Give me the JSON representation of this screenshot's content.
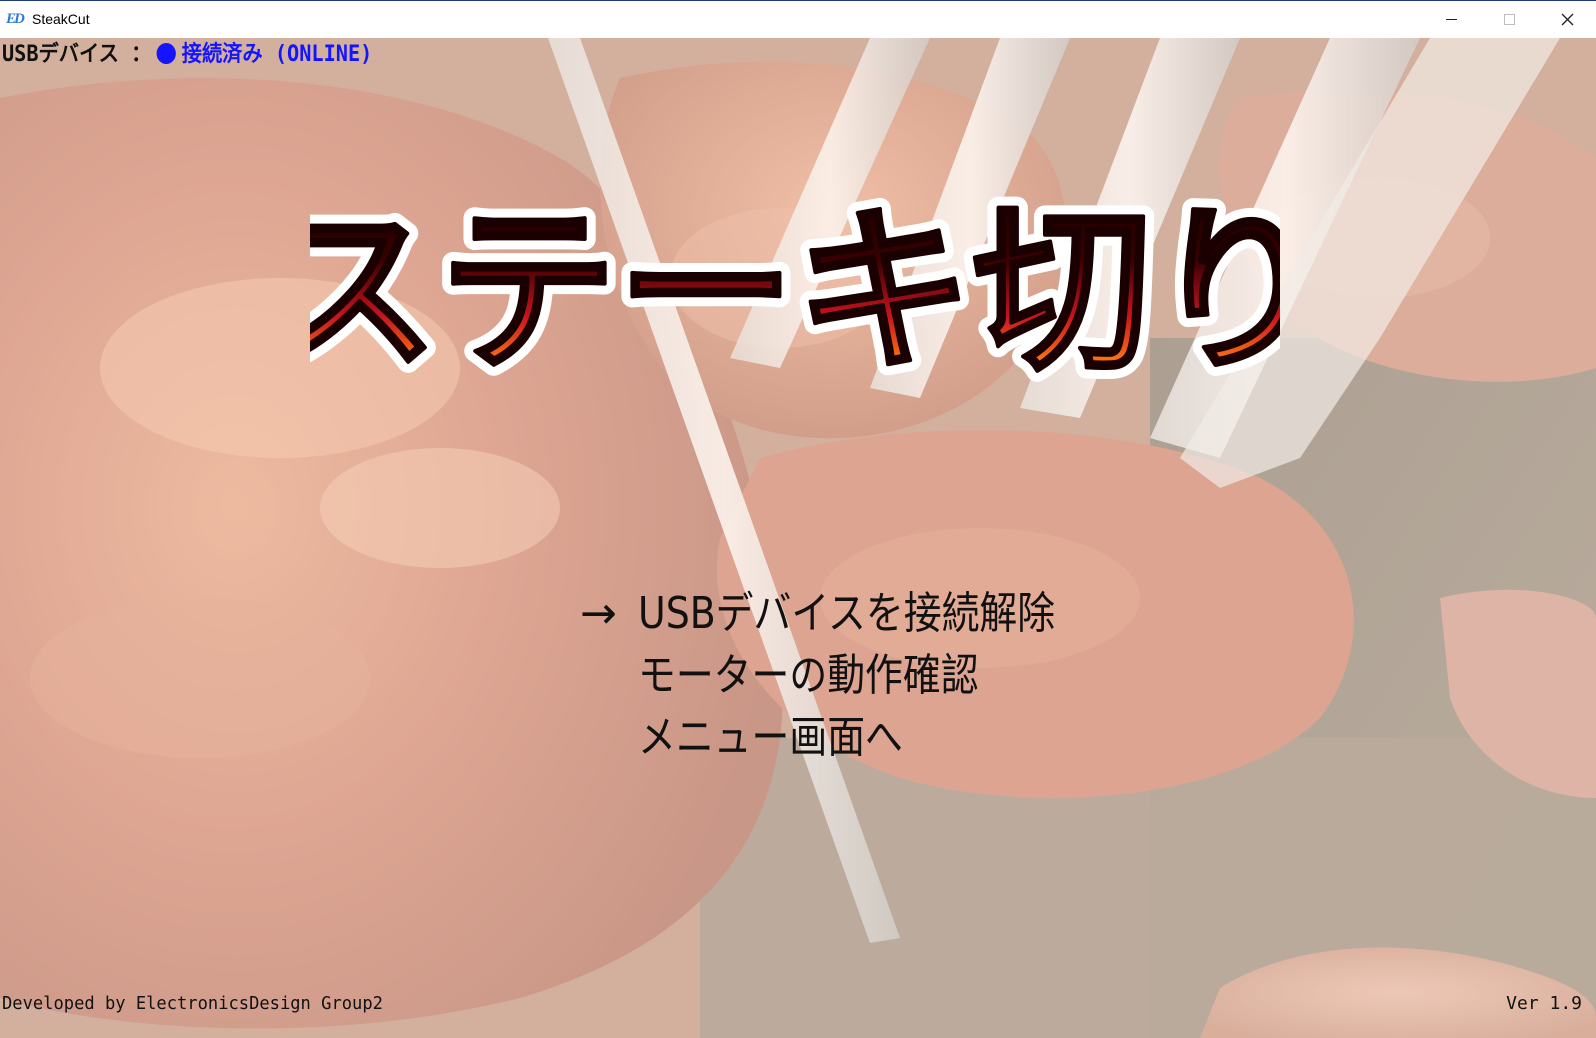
{
  "window": {
    "title": "SteakCut",
    "icon_text": "ED",
    "controls": {
      "minimize": "minimize-icon",
      "maximize": "maximize-icon",
      "close": "close-icon"
    }
  },
  "status": {
    "label": "USBデバイス ：",
    "state": "接続済み (ONLINE)",
    "state_color": "#1414ff"
  },
  "logo": {
    "text": "ステーキ切り"
  },
  "menu": {
    "cursor": "→",
    "items": [
      {
        "label": "USBデバイスを接続解除",
        "selected": true
      },
      {
        "label": "モーターの動作確認",
        "selected": false
      },
      {
        "label": "メニュー画面へ",
        "selected": false
      }
    ]
  },
  "footer": {
    "developer": "Developed by ElectronicsDesign Group2",
    "version": "Ver 1.9"
  },
  "colors": {
    "background_wash": "#fff0e1",
    "logo_fill_top": "#1a0000",
    "logo_fill_mid": "#c8141e",
    "logo_fill_bottom": "#ffd200",
    "logo_outline": "#ffffff"
  }
}
